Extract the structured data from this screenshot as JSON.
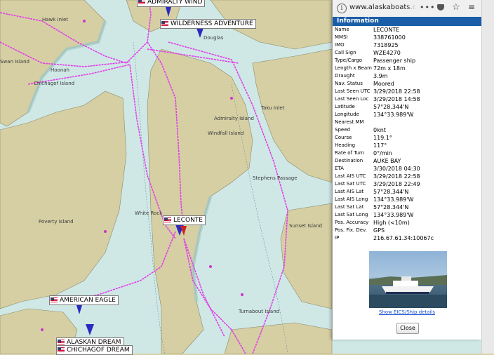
{
  "browser": {
    "url": "www.alaskaboats.co",
    "info_icon": "i",
    "more_icon": "•••",
    "star_icon": "☆",
    "menu_icon": "≡"
  },
  "map": {
    "ship_labels": [
      "ADMIRALTY WIND",
      "WILDERNESS ADVENTURE",
      "LECONTE",
      "AMERICAN EAGLE",
      "ALASKAN DREAM",
      "CHICHAGOF DREAM"
    ],
    "place_names": [
      "Hawk Inlet",
      "Swan Island",
      "Chichagof Island",
      "Douglas",
      "Admiralty Island",
      "Windfall Island",
      "Poverty Island",
      "White Rock",
      "Turnabout Island",
      "Sunset Island",
      "Stephens Passage",
      "Taku Inlet",
      "Hoonah"
    ],
    "colors": {
      "water": "#cfe8e6",
      "land": "#d6cfa3",
      "route": "#e040e8",
      "ship": "#2a2ac0"
    }
  },
  "popup": {
    "header": "Information",
    "rows": [
      {
        "label": "Name",
        "value": "LECONTE"
      },
      {
        "label": "MMSI",
        "value": "338761000"
      },
      {
        "label": "IMO",
        "value": "7318925"
      },
      {
        "label": "Call Sign",
        "value": "WZE4270"
      },
      {
        "label": "Type/Cargo",
        "value": "Passenger ship"
      },
      {
        "label": "Length x Beam",
        "value": "72m x 18m"
      },
      {
        "label": "Draught",
        "value": "3.9m"
      },
      {
        "label": "Nav. Status",
        "value": "Moored"
      },
      {
        "label": "Last Seen UTC",
        "value": "3/29/2018 22:58"
      },
      {
        "label": "Last Seen Loc",
        "value": "3/29/2018 14:58"
      },
      {
        "label": "Latitude",
        "value": "57°28.344'N"
      },
      {
        "label": "Longitude",
        "value": "134°33.989'W"
      },
      {
        "label": "Nearest MM",
        "value": ""
      },
      {
        "label": "Speed",
        "value": "0knt"
      },
      {
        "label": "Course",
        "value": "119.1°"
      },
      {
        "label": "Heading",
        "value": "117°"
      },
      {
        "label": "Rate of Turn",
        "value": "0°/min"
      },
      {
        "label": "Destination",
        "value": "AUKE BAY"
      },
      {
        "label": "ETA",
        "value": "3/30/2018 04:30"
      },
      {
        "label": "Last AIS UTC",
        "value": "3/29/2018 22:58"
      },
      {
        "label": "Last Sat UTC",
        "value": "3/29/2018 22:49"
      },
      {
        "label": "Last AIS Lat",
        "value": "57°28.344'N"
      },
      {
        "label": "Last AIS Long",
        "value": "134°33.989'W"
      },
      {
        "label": "Last Sat Lat",
        "value": "57°28.344'N"
      },
      {
        "label": "Last Sat Long",
        "value": "134°33.989'W"
      },
      {
        "label": "Pos. Accuracy",
        "value": "High (<10m)"
      },
      {
        "label": "Pos. Fix. Dev.",
        "value": "GPS"
      },
      {
        "label": "IP",
        "value": "216.67.61.34:10067c"
      }
    ],
    "photo_link": "Show EICS/Ship details",
    "close_label": "Close"
  }
}
